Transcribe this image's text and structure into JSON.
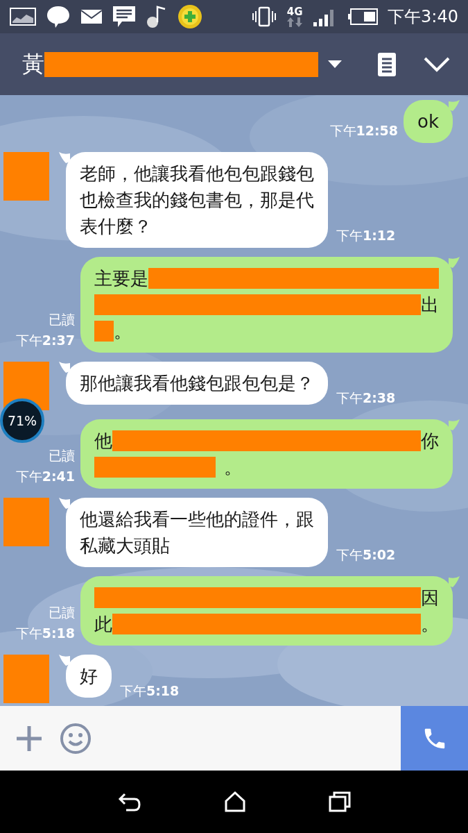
{
  "status_bar": {
    "network": "4G",
    "time": "下午3:40"
  },
  "header": {
    "title": "黃"
  },
  "messages": [
    {
      "kind": "sent",
      "lines": [
        [
          {
            "kind": "text",
            "text": "ok"
          }
        ]
      ],
      "time": "下午**12:58**"
    },
    {
      "kind": "received",
      "lines": [
        [
          {
            "kind": "text",
            "text": "老師，他讓我看他包包跟錢包"
          }
        ],
        [
          {
            "kind": "text",
            "text": "也檢查我的錢包書包，那是代"
          }
        ],
        [
          {
            "kind": "text",
            "text": "表什麼？"
          }
        ]
      ],
      "time": "下午**1:12**"
    },
    {
      "kind": "sent",
      "lines": [
        [
          {
            "kind": "text",
            "text": "主要是"
          },
          {
            "kind": "redaction"
          }
        ],
        [
          {
            "kind": "redaction"
          },
          {
            "kind": "text",
            "text": "出"
          }
        ],
        [
          {
            "kind": "redaction_short"
          },
          {
            "kind": "text",
            "text": "。"
          }
        ]
      ],
      "read_label": "已讀",
      "time": "下午**2:37**"
    },
    {
      "kind": "received",
      "lines": [
        [
          {
            "kind": "text",
            "text": "那他讓我看他錢包跟包包是？"
          }
        ]
      ],
      "time": "下午**2:38**"
    },
    {
      "kind": "sent",
      "lines": [
        [
          {
            "kind": "text",
            "text": "他"
          },
          {
            "kind": "redaction"
          },
          {
            "kind": "text",
            "text": "你"
          }
        ],
        [
          {
            "kind": "redaction_mid"
          },
          {
            "kind": "text",
            "text": "。"
          }
        ]
      ],
      "read_label": "已讀",
      "time": "下午**2:41**"
    },
    {
      "kind": "received",
      "lines": [
        [
          {
            "kind": "text",
            "text": "他還給我看一些他的證件，跟"
          }
        ],
        [
          {
            "kind": "text",
            "text": "私藏大頭貼"
          }
        ]
      ],
      "time": "下午**5:02**"
    },
    {
      "kind": "sent",
      "lines": [
        [
          {
            "kind": "redaction"
          },
          {
            "kind": "text",
            "text": "因"
          }
        ],
        [
          {
            "kind": "text",
            "text": "此"
          },
          {
            "kind": "redaction"
          },
          {
            "kind": "text",
            "text": "。"
          }
        ]
      ],
      "read_label": "已讀",
      "time": "下午**5:18**"
    },
    {
      "kind": "received",
      "lines": [
        [
          {
            "kind": "text",
            "text": "好"
          }
        ]
      ],
      "time": "下午**5:18**"
    }
  ],
  "overlay_widget": {
    "reading": "71%"
  }
}
